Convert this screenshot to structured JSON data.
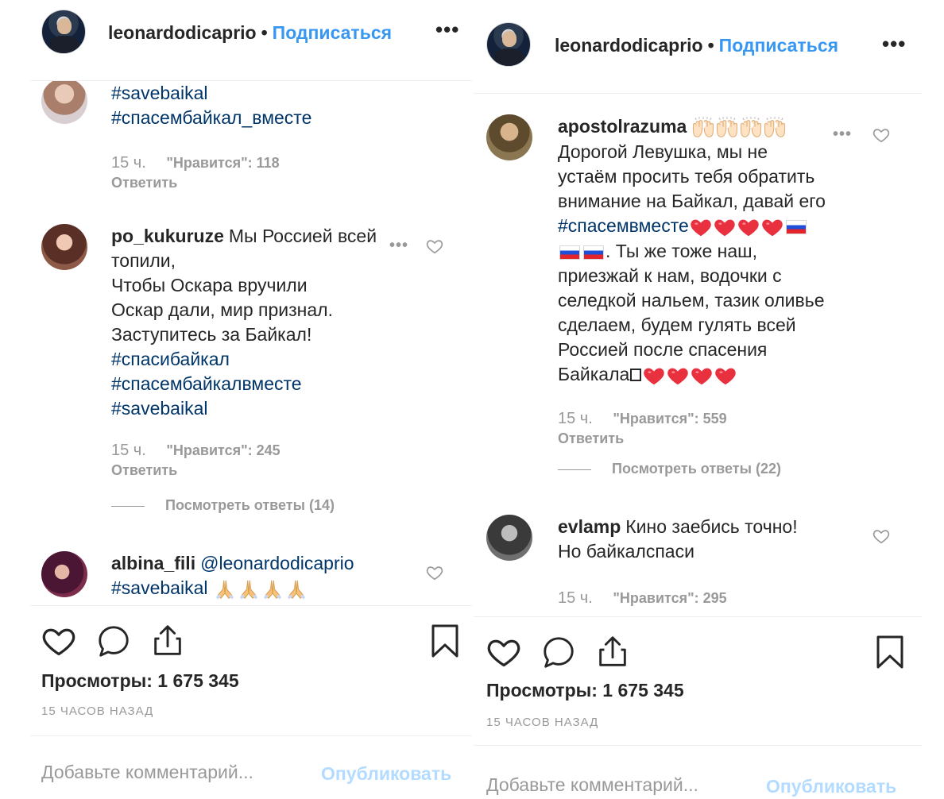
{
  "left": {
    "owner": "leonardodicaprio",
    "separator": "•",
    "follow": "Подписаться",
    "more": "•••",
    "comments": [
      {
        "lines": [
          "#savebaikal",
          "#спасембайкал_вместе"
        ],
        "time": "15 ч.",
        "likes": "\"Нравится\": 118",
        "reply": "Ответить"
      },
      {
        "user": "po_kukuruze",
        "lines": [
          "Мы Россией всей",
          "топили,",
          "Чтобы Оскара вручили",
          "Оскар дали, мир признал.",
          "Заступитесь за Байкал!",
          "#спасибайкал",
          "#спасембайкалвместе",
          "#savebaikal"
        ],
        "time": "15 ч.",
        "likes": "\"Нравится\": 245",
        "reply": "Ответить",
        "view_replies": "Посмотреть ответы (14)"
      },
      {
        "user": "albina_fili",
        "mention": "@leonardodicaprio",
        "hashtag": "#savebaikal"
      }
    ],
    "views": "Просмотры: 1 675 345",
    "ago": "15 ЧАСОВ НАЗАД",
    "add_comment_placeholder": "Добавьте комментарий...",
    "publish": "Опубликовать"
  },
  "right": {
    "owner": "leonardodicaprio",
    "separator": "•",
    "follow": "Подписаться",
    "more": "•••",
    "comments": [
      {
        "user": "apostolrazuma",
        "lines": [
          "Дорогой Левушка, мы не",
          "устаём просить тебя обратить",
          "внимание на Байкал, давай его"
        ],
        "hashtag": "#спасемвместе",
        "after_flags": ". Ты же тоже наш,",
        "more_lines": [
          "приезжай к нам, водочки с",
          "селедкой нальем, тазик оливье",
          "сделаем, будем гулять всей",
          "Россией после спасения"
        ],
        "last_word": "Байкала",
        "time": "15 ч.",
        "likes": "\"Нравится\": 559",
        "reply": "Ответить",
        "view_replies": "Посмотреть ответы (22)"
      },
      {
        "user": "evlamp",
        "lines": [
          "Кино заебись точно!",
          "Но байкалспаси"
        ],
        "time": "15 ч.",
        "likes": "\"Нравится\": 295"
      }
    ],
    "views": "Просмотры: 1 675 345",
    "ago": "15 ЧАСОВ НАЗАД",
    "add_comment_placeholder": "Добавьте комментарий...",
    "publish": "Опубликовать"
  },
  "icons": [
    "heart-icon",
    "comment-icon",
    "share-icon",
    "bookmark-icon",
    "more-icon",
    "praying-hands-emoji",
    "raising-hands-emoji",
    "red-heart-emoji",
    "russia-flag-emoji"
  ],
  "colors": {
    "text": "#262626",
    "muted": "#999999",
    "link": "#3897f0",
    "hashtag": "#003569",
    "publish_disabled": "#b3dbff",
    "heart_red": "#e0245e"
  }
}
